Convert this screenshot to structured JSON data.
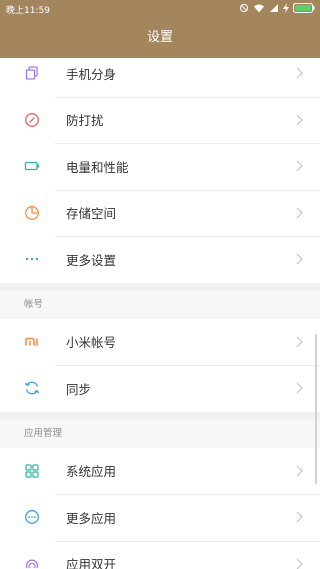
{
  "status": {
    "time": "晚上11:59"
  },
  "header": {
    "title": "设置"
  },
  "top_items": [
    {
      "label": "手机分身",
      "icon": "dual-phone-icon"
    },
    {
      "label": "防打扰",
      "icon": "do-not-disturb-icon"
    },
    {
      "label": "电量和性能",
      "icon": "battery-icon"
    },
    {
      "label": "存储空间",
      "icon": "storage-icon"
    },
    {
      "label": "更多设置",
      "icon": "more-dots-icon"
    }
  ],
  "account": {
    "header": "帐号",
    "items": [
      {
        "label": "小米帐号",
        "icon": "mi-logo-icon"
      },
      {
        "label": "同步",
        "icon": "sync-icon"
      }
    ]
  },
  "apps": {
    "header": "应用管理",
    "items": [
      {
        "label": "系统应用",
        "icon": "grid-apps-icon"
      },
      {
        "label": "更多应用",
        "icon": "more-apps-icon"
      },
      {
        "label": "应用双开",
        "icon": "dual-apps-icon"
      }
    ]
  },
  "colors": {
    "header_bg": "#a4865e",
    "accent_blue": "#3aa1e6",
    "accent_orange": "#ff8a3c",
    "accent_teal": "#2bb5a5",
    "accent_red": "#f06060",
    "accent_purple": "#9a7cf0"
  }
}
